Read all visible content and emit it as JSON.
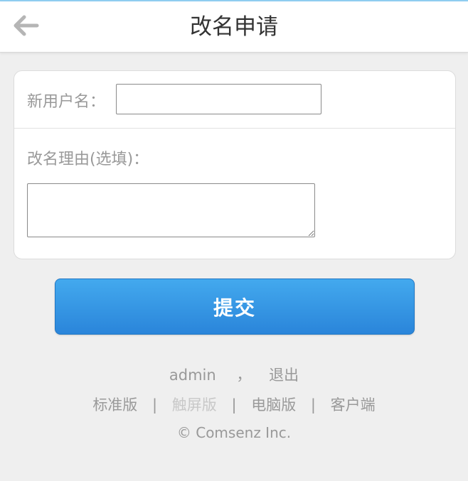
{
  "header": {
    "title": "改名申请",
    "back_icon": "arrow-left-icon"
  },
  "form": {
    "new_username_label": "新用户名：",
    "new_username_value": "",
    "reason_label": "改名理由(选填)：",
    "reason_value": ""
  },
  "submit": {
    "label": "提交"
  },
  "footer": {
    "username": "admin",
    "comma": "，",
    "logout": "退出",
    "links": {
      "standard": "标准版",
      "touch": "触屏版",
      "desktop": "电脑版",
      "client": "客户端"
    },
    "separator": "|",
    "copyright": "© Comsenz Inc."
  },
  "colors": {
    "button_top": "#43a9ee",
    "button_bottom": "#2a85da",
    "text_gray": "#999999",
    "accent_line": "#8fcdf0"
  }
}
